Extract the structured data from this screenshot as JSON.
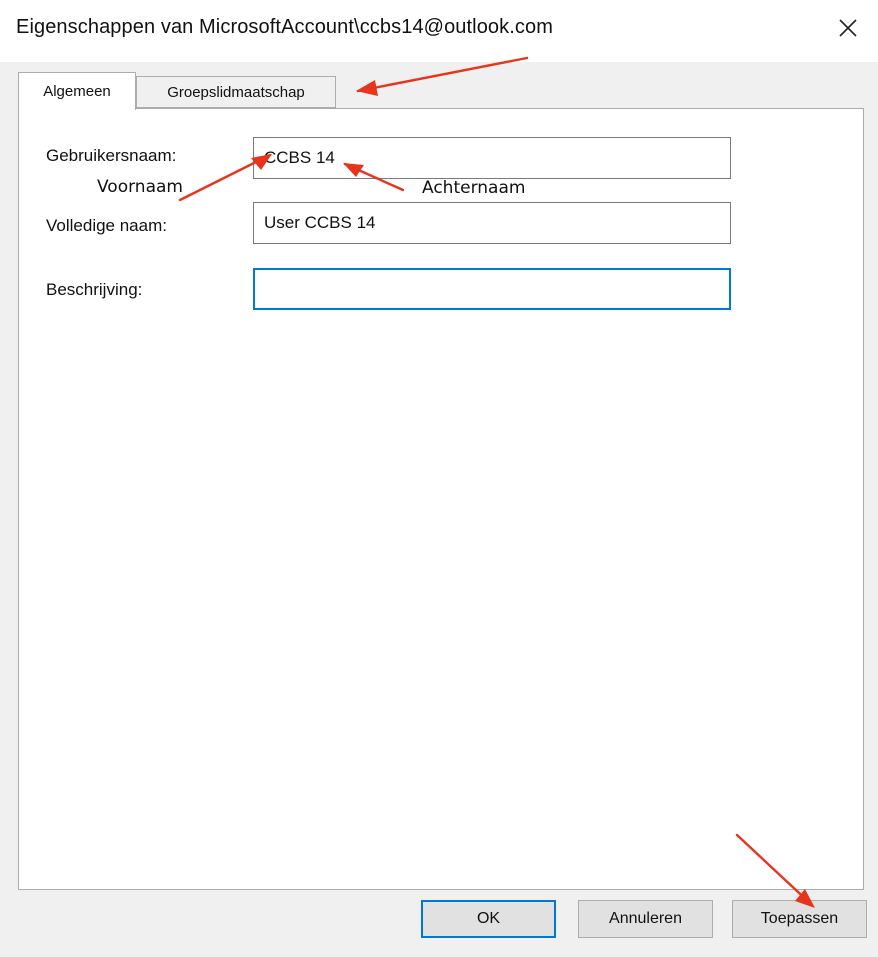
{
  "window": {
    "title": "Eigenschappen van MicrosoftAccount\\ccbs14@outlook.com",
    "close_icon": "close-icon"
  },
  "tabs": [
    {
      "label": "Algemeen",
      "active": true
    },
    {
      "label": "Groepslidmaatschap",
      "active": false
    }
  ],
  "form": {
    "username": {
      "label": "Gebruikersnaam:",
      "value": "CCBS 14"
    },
    "fullname": {
      "label": "Volledige naam:",
      "value": "User CCBS 14"
    },
    "description": {
      "label": "Beschrijving:",
      "value": ""
    }
  },
  "annotations": {
    "firstname": "Voornaam",
    "lastname": "Achternaam",
    "arrow_color": "#e8341c"
  },
  "buttons": {
    "ok": "OK",
    "cancel": "Annuleren",
    "apply": "Toepassen"
  },
  "colors": {
    "accent": "#0078d7",
    "dialog_bg": "#f0f0f0",
    "annotation_arrow": "#e8341c"
  }
}
